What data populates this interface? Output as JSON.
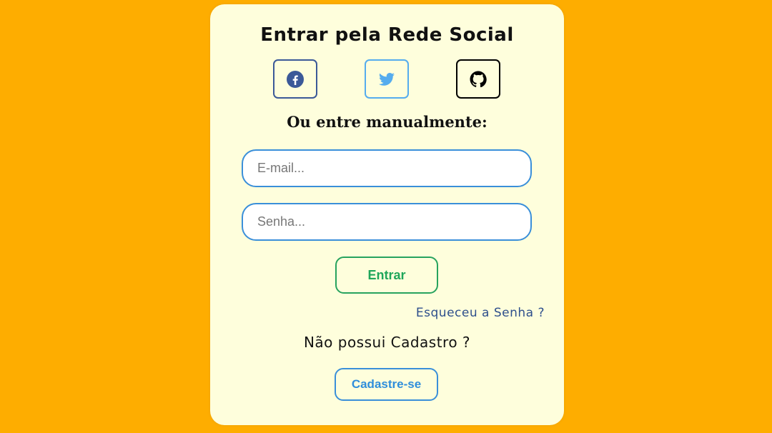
{
  "login": {
    "title": "Entrar pela Rede Social",
    "social_buttons": [
      {
        "name": "facebook",
        "icon": "facebook-icon",
        "color": "#3B5998"
      },
      {
        "name": "twitter",
        "icon": "twitter-icon",
        "color": "#55ACEE"
      },
      {
        "name": "github",
        "icon": "github-icon",
        "color": "#000000"
      }
    ],
    "manual_label": "Ou entre manualmente:",
    "email_placeholder": "E-mail...",
    "email_value": "",
    "password_placeholder": "Senha...",
    "password_value": "",
    "submit_label": "Entrar",
    "forgot_label": "Esqueceu a Senha ?",
    "no_account_label": "Não possui Cadastro ?",
    "register_label": "Cadastre-se"
  },
  "colors": {
    "background": "#FEAD00",
    "card": "#FEFEDC",
    "submit_green": "#27A35E",
    "input_border_blue": "#3A8FD9",
    "link_blue": "#2E4F8C"
  }
}
